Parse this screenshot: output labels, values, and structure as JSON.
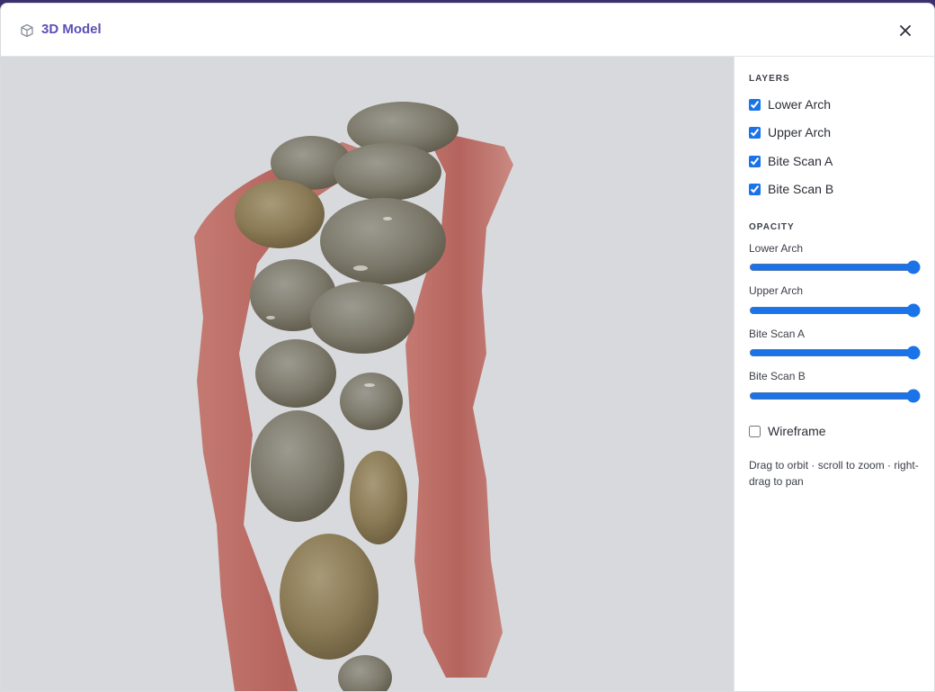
{
  "window": {
    "title": "3D Model",
    "close_icon": "close-icon",
    "cube_icon": "cube-icon"
  },
  "colors": {
    "accent": "#1a73e8",
    "title": "#5b4fb8",
    "viewport_bg": "#d8d9dc"
  },
  "layers": {
    "heading": "LAYERS",
    "items": [
      {
        "label": "Lower Arch",
        "checked": true
      },
      {
        "label": "Upper Arch",
        "checked": true
      },
      {
        "label": "Bite Scan A",
        "checked": true
      },
      {
        "label": "Bite Scan B",
        "checked": true
      }
    ]
  },
  "opacity": {
    "heading": "OPACITY",
    "items": [
      {
        "label": "Lower Arch",
        "value": 1.0
      },
      {
        "label": "Upper Arch",
        "value": 1.0
      },
      {
        "label": "Bite Scan A",
        "value": 1.0
      },
      {
        "label": "Bite Scan B",
        "value": 1.0
      }
    ]
  },
  "wireframe": {
    "label": "Wireframe",
    "checked": false
  },
  "hint": "Drag to orbit · scroll to zoom · right-drag to pan"
}
